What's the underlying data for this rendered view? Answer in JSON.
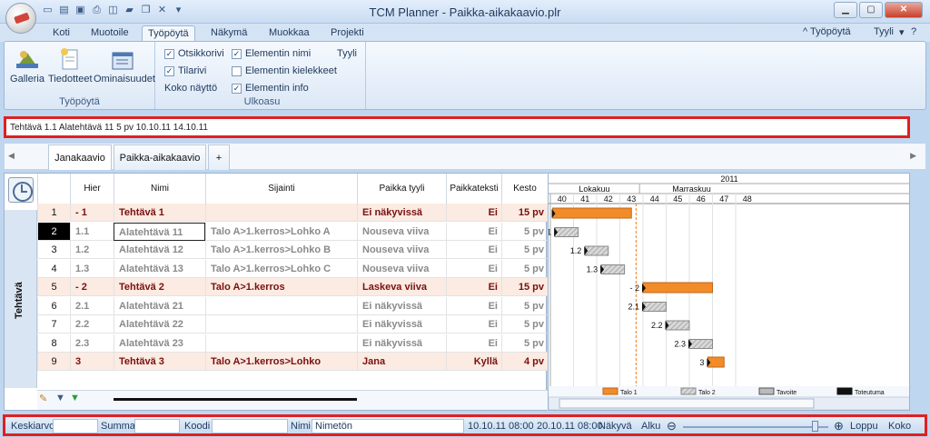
{
  "app": {
    "title": "TCM Planner - Paikka-aikakaavio.plr"
  },
  "ribbon_tabs": [
    "Koti",
    "Muotoile",
    "Työpöytä",
    "Näkymä",
    "Muokkaa",
    "Projekti"
  ],
  "ribbon_right": {
    "workspace": "^ Työpöytä",
    "style": "Tyyli"
  },
  "ribbon": {
    "group1": {
      "label": "Työpöytä",
      "buttons": [
        "Galleria",
        "Tiedotteet",
        "Ominaisuudet"
      ]
    },
    "group2": {
      "label": "Ulkoasu",
      "options": [
        {
          "label": "Otsikkorivi",
          "checked": true
        },
        {
          "label": "Tilarivi",
          "checked": true
        },
        {
          "label": "Koko näyttö",
          "checked": false,
          "plain": true
        },
        {
          "label": "Elementin nimi",
          "checked": true
        },
        {
          "label": "Elementin kielekkeet",
          "checked": false
        },
        {
          "label": "Elementin info",
          "checked": true
        }
      ],
      "style_label": "Tyyli"
    }
  },
  "info_bar": "Tehtävä 1.1  Alatehtävä 11  5 pv  10.10.11  14.10.11",
  "doc_tabs": [
    "Janakaavio",
    "Paikka-aikakaavio",
    "+"
  ],
  "grid": {
    "side_label": "Tehtävä",
    "columns": [
      "Hier",
      "Nimi",
      "Sijainti",
      "Paikka tyyli",
      "Paikkateksti",
      "Kesto"
    ],
    "rows": [
      {
        "n": "1",
        "hier": "- 1",
        "name": "Tehtävä 1",
        "loc": "",
        "style": "Ei näkyvissä",
        "text": "Ei",
        "dur": "15 pv",
        "kind": "sum"
      },
      {
        "n": "2",
        "hier": "1.1",
        "name": "Alatehtävä 11",
        "loc": "Talo A>1.kerros>Lohko A",
        "style": "Nouseva viiva",
        "text": "Ei",
        "dur": "5 pv",
        "kind": "sub"
      },
      {
        "n": "3",
        "hier": "1.2",
        "name": "Alatehtävä 12",
        "loc": "Talo A>1.kerros>Lohko B",
        "style": "Nouseva viiva",
        "text": "Ei",
        "dur": "5 pv",
        "kind": "sub"
      },
      {
        "n": "4",
        "hier": "1.3",
        "name": "Alatehtävä 13",
        "loc": "Talo A>1.kerros>Lohko C",
        "style": "Nouseva viiva",
        "text": "Ei",
        "dur": "5 pv",
        "kind": "sub"
      },
      {
        "n": "5",
        "hier": "- 2",
        "name": "Tehtävä 2",
        "loc": "Talo A>1.kerros",
        "style": "Laskeva viiva",
        "text": "Ei",
        "dur": "15 pv",
        "kind": "sum"
      },
      {
        "n": "6",
        "hier": "2.1",
        "name": "Alatehtävä 21",
        "loc": "",
        "style": "Ei näkyvissä",
        "text": "Ei",
        "dur": "5 pv",
        "kind": "sub"
      },
      {
        "n": "7",
        "hier": "2.2",
        "name": "Alatehtävä 22",
        "loc": "",
        "style": "Ei näkyvissä",
        "text": "Ei",
        "dur": "5 pv",
        "kind": "sub"
      },
      {
        "n": "8",
        "hier": "2.3",
        "name": "Alatehtävä 23",
        "loc": "",
        "style": "Ei näkyvissä",
        "text": "Ei",
        "dur": "5 pv",
        "kind": "sub"
      },
      {
        "n": "9",
        "hier": "3",
        "name": "Tehtävä 3",
        "loc": "Talo A>1.kerros>Lohko",
        "style": "Jana",
        "text": "Kyllä",
        "dur": "4 pv",
        "kind": "sum"
      }
    ]
  },
  "gantt": {
    "year": "2011",
    "months": [
      "Lokakuu",
      "Marraskuu"
    ],
    "weeks": [
      "40",
      "41",
      "42",
      "43",
      "44",
      "45",
      "46",
      "47",
      "48"
    ],
    "legend": [
      "Talo 1",
      "Talo 2",
      "Tavoite",
      "Toteutuma"
    ],
    "colors": {
      "summary": "#f28c28",
      "sub": "#c8c8c8",
      "deadline": "#f07a1a"
    },
    "bars": [
      {
        "label": "- 1",
        "start": 40.1,
        "end": 43.5,
        "kind": "sum"
      },
      {
        "label": "1.1",
        "start": 40.2,
        "end": 41.2,
        "kind": "sub"
      },
      {
        "label": "1.2",
        "start": 41.5,
        "end": 42.5,
        "kind": "sub"
      },
      {
        "label": "1.3",
        "start": 42.2,
        "end": 43.2,
        "kind": "sub"
      },
      {
        "label": "- 2",
        "start": 44.0,
        "end": 47.0,
        "kind": "sum"
      },
      {
        "label": "2.1",
        "start": 44.0,
        "end": 45.0,
        "kind": "sub"
      },
      {
        "label": "2.2",
        "start": 45.0,
        "end": 46.0,
        "kind": "sub"
      },
      {
        "label": "2.3",
        "start": 46.0,
        "end": 47.0,
        "kind": "sub"
      },
      {
        "label": "3",
        "start": 46.8,
        "end": 47.5,
        "kind": "sum"
      }
    ],
    "today_week": 43.7
  },
  "status": {
    "avg_label": "Keskiarvo",
    "sum_label": "Summa",
    "code_label": "Koodi",
    "name_label": "Nimi",
    "name_value": "Nimetön",
    "start_date": "10.10.11 08:00",
    "end_date": "20.10.11 08:00",
    "view_label": "Näkyvä",
    "begin_label": "Alku",
    "end_label": "Loppu",
    "size_label": "Koko"
  }
}
